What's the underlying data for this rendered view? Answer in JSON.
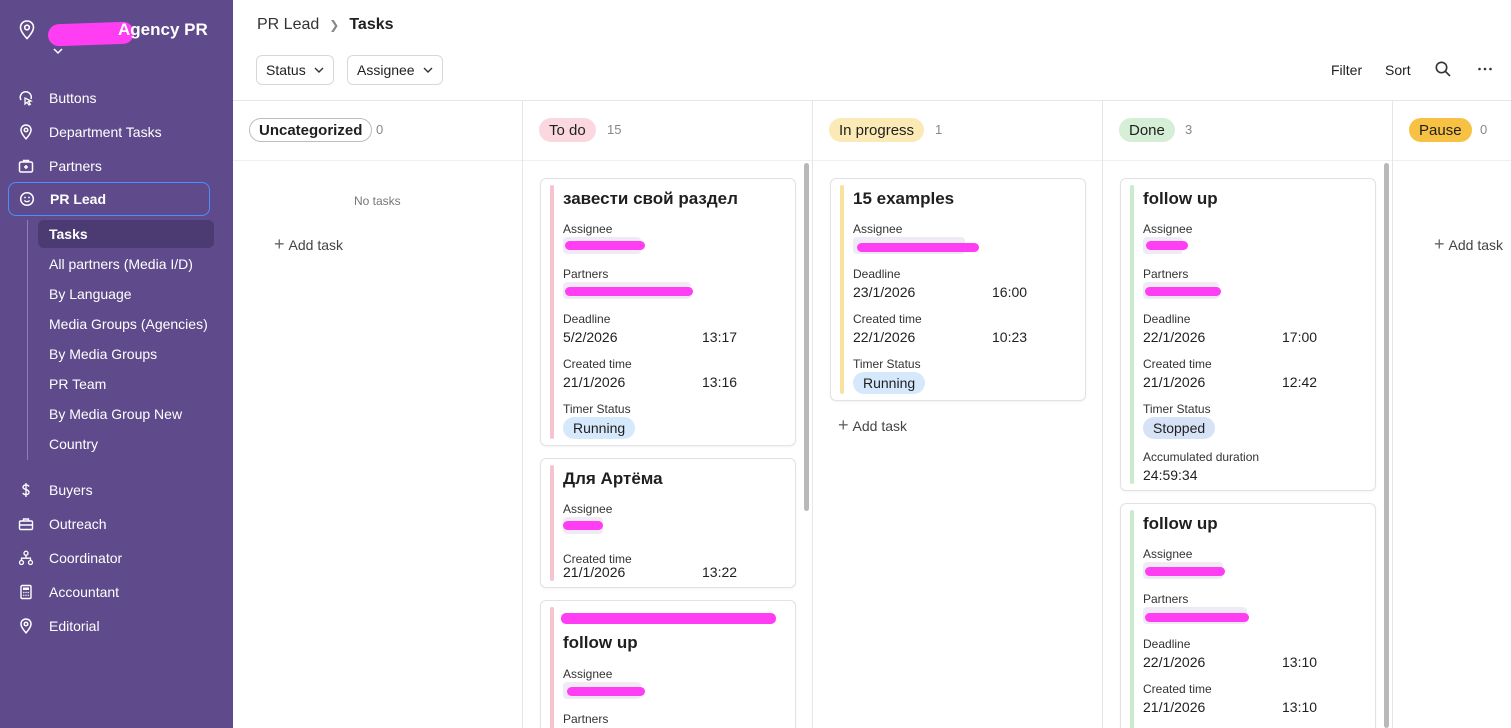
{
  "sidebar": {
    "org_name": "Agency PR",
    "items": [
      {
        "label": "Buttons",
        "icon": "buttons-icon"
      },
      {
        "label": "Department Tasks",
        "icon": "pin-icon"
      },
      {
        "label": "Partners",
        "icon": "briefcase-plus-icon"
      },
      {
        "label": "PR Lead",
        "icon": "smiley-icon"
      },
      {
        "label": "Buyers",
        "icon": "dollar-icon"
      },
      {
        "label": "Outreach",
        "icon": "toolbox-icon"
      },
      {
        "label": "Coordinator",
        "icon": "hierarchy-icon"
      },
      {
        "label": "Accountant",
        "icon": "calculator-icon"
      },
      {
        "label": "Editorial",
        "icon": "pin-icon"
      }
    ],
    "sub_items": [
      "Tasks",
      "All partners (Media I/D)",
      "By Language",
      "Media Groups (Agencies)",
      "By Media Groups",
      "PR Team",
      "By Media Group New",
      "Country"
    ]
  },
  "header": {
    "breadcrumb": [
      "PR Lead",
      "Tasks"
    ],
    "status_label": "Status",
    "assignee_label": "Assignee",
    "filter_label": "Filter",
    "sort_label": "Sort"
  },
  "columns": [
    {
      "title": "Uncategorized",
      "count": "0",
      "empty_text": "No tasks",
      "add_label": "Add task"
    },
    {
      "title": "To do",
      "count": "15"
    },
    {
      "title": "In progress",
      "count": "1",
      "add_label": "Add task"
    },
    {
      "title": "Done",
      "count": "3"
    },
    {
      "title": "Pause",
      "count": "0",
      "add_label": "Add task"
    }
  ],
  "labels": {
    "assignee": "Assignee",
    "partners": "Partners",
    "deadline": "Deadline",
    "created": "Created time",
    "timer": "Timer Status",
    "accum": "Accumulated duration"
  },
  "cards": {
    "todo1": {
      "title": "завести свой раздел",
      "deadline_date": "5/2/2026",
      "deadline_time": "13:17",
      "created_date": "21/1/2026",
      "created_time": "13:16",
      "timer": "Running"
    },
    "todo2": {
      "title": "Для Артёма",
      "created_date": "21/1/2026",
      "created_time": "13:22"
    },
    "todo3": {
      "title": "follow up"
    },
    "prog1": {
      "title": "15 examples",
      "deadline_date": "23/1/2026",
      "deadline_time": "16:00",
      "created_date": "22/1/2026",
      "created_time": "10:23",
      "timer": "Running"
    },
    "done1": {
      "title": "follow up",
      "deadline_date": "22/1/2026",
      "deadline_time": "17:00",
      "created_date": "21/1/2026",
      "created_time": "12:42",
      "timer": "Stopped",
      "accum": "24:59:34"
    },
    "done2": {
      "title": "follow up",
      "deadline_date": "22/1/2026",
      "deadline_time": "13:10",
      "created_date": "21/1/2026",
      "created_time": "13:10"
    }
  },
  "colors": {
    "sidebar": "#5f4b8b",
    "todo": "#fbd8e0",
    "in_progress": "#fbe9b6",
    "done": "#d4efd6",
    "pause": "#f7c244",
    "redaction": "#ff3df3"
  }
}
